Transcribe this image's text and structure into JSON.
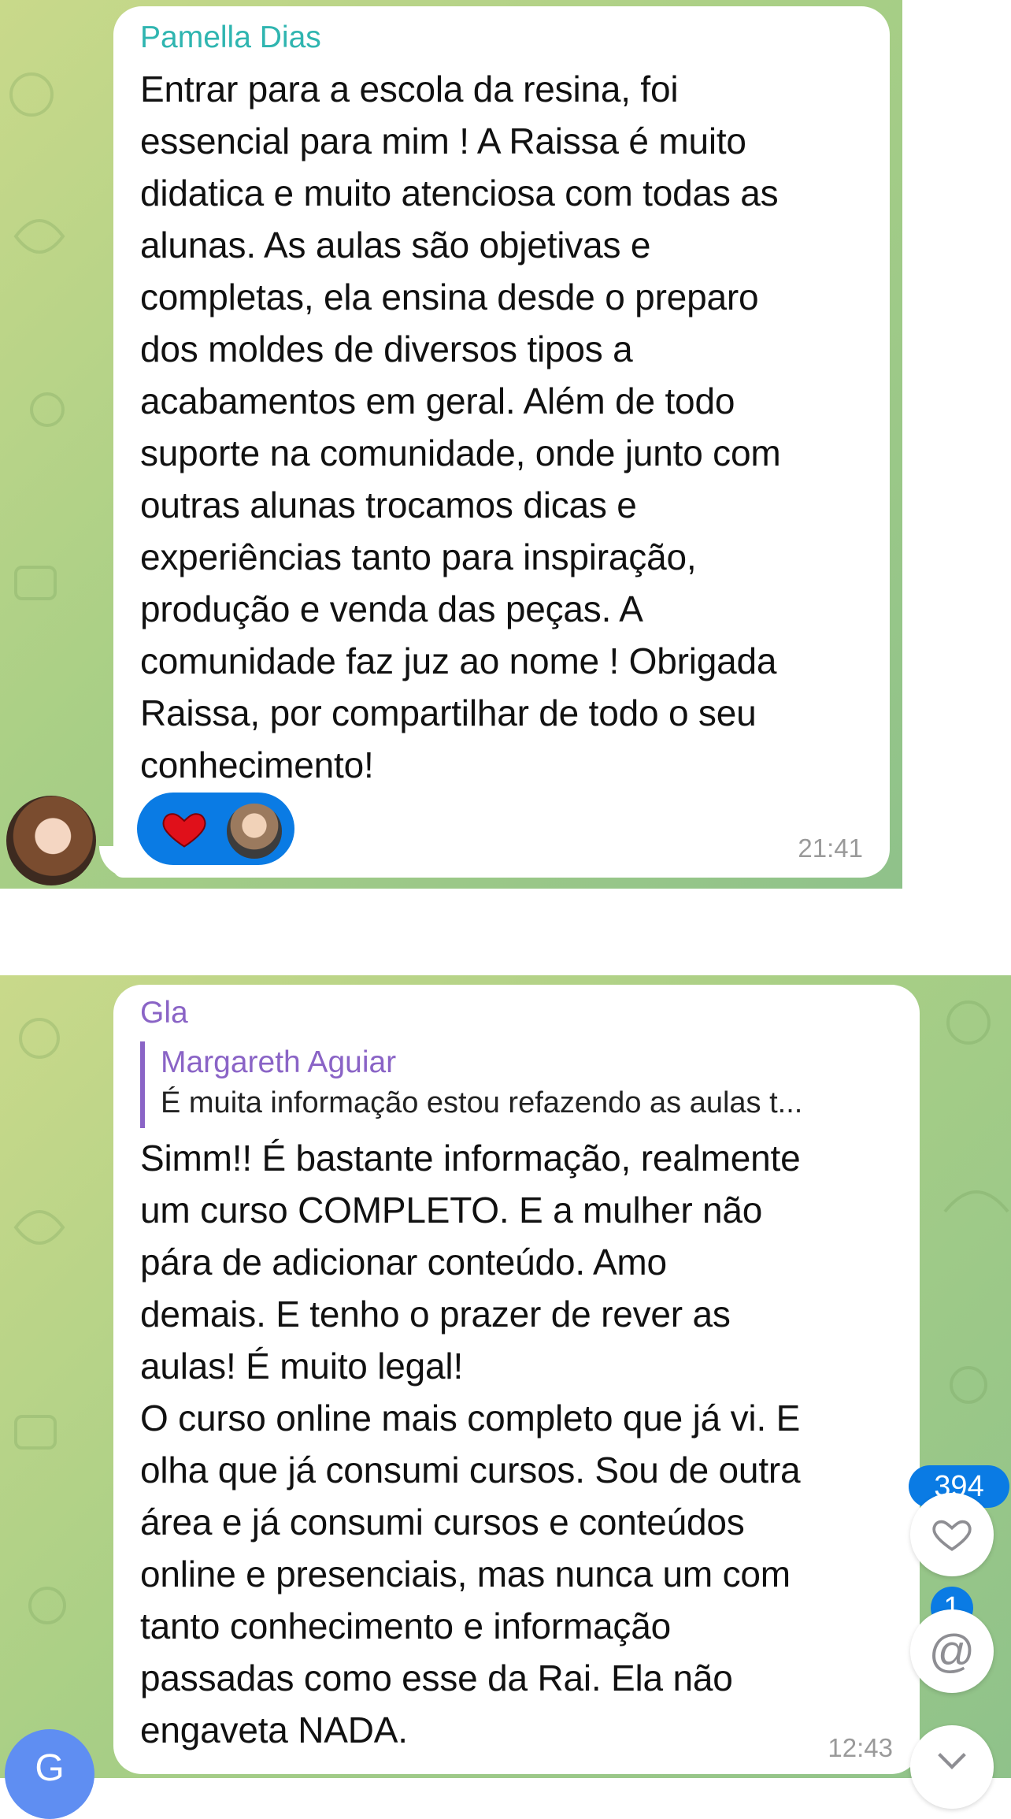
{
  "message1": {
    "sender": "Pamella Dias",
    "text": "Entrar para a escola da resina, foi\nessencial para mim ! A Raissa é muito\ndidatica e muito atenciosa com todas as\nalunas. As aulas são objetivas e\ncompletas, ela ensina desde o preparo\ndos moldes de diversos tipos a\nacabamentos em geral. Além de todo\nsuporte na comunidade, onde junto com\noutras alunas trocamos dicas e\nexperiências tanto para inspiração,\nprodução e venda das peças. A\ncomunidade faz juz ao nome ! Obrigada\nRaissa, por compartilhar de todo o seu\nconhecimento!",
    "time": "21:41",
    "reaction": {
      "icon": "heart-icon",
      "color": "#e0101a"
    }
  },
  "message2": {
    "sender": "Gla",
    "reply": {
      "name": "Margareth Aguiar",
      "text": "É muita informação estou refazendo as aulas t..."
    },
    "text": "Simm!! É bastante informação, realmente\num curso COMPLETO. E a mulher não\npára de adicionar conteúdo. Amo\ndemais. E tenho o prazer de rever as\naulas! É muito legal!\nO curso online mais completo que já vi. E\nolha que já consumi cursos. Sou de outra\nárea e já consumi cursos e conteúdos\nonline e presenciais, mas nunca um com\ntanto conhecimento e informação\npassadas como esse da Rai. Ela não\nengaveta NADA.",
    "time": "12:43"
  },
  "side_buttons": {
    "likes_count": "394",
    "mentions_count": "1",
    "mention_symbol": "@"
  },
  "avatar_g_initial": "G",
  "colors": {
    "accent_blue": "#0a7be4",
    "sender1": "#2fb5b0",
    "sender2": "#8a64c6"
  }
}
